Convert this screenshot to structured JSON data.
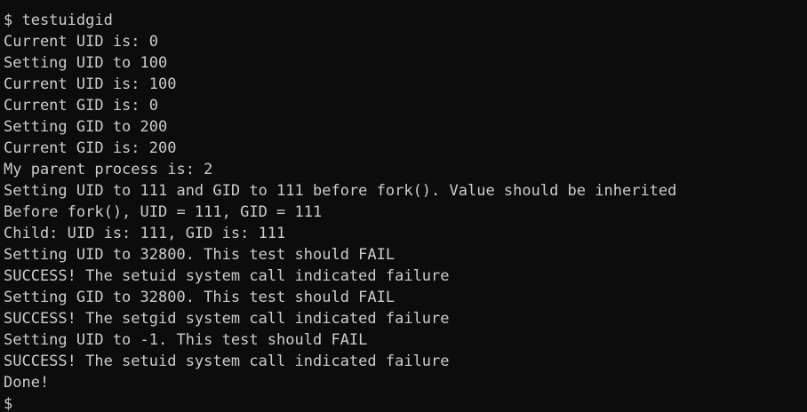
{
  "terminal": {
    "background": "#0c0c0c",
    "foreground": "#cccccc",
    "lines": [
      "$ testuidgid",
      "Current UID is: 0",
      "Setting UID to 100",
      "Current UID is: 100",
      "Current GID is: 0",
      "Setting GID to 200",
      "Current GID is: 200",
      "My parent process is: 2",
      "Setting UID to 111 and GID to 111 before fork(). Value should be inherited",
      "Before fork(), UID = 111, GID = 111",
      "Child: UID is: 111, GID is: 111",
      "Setting UID to 32800. This test should FAIL",
      "SUCCESS! The setuid system call indicated failure",
      "Setting GID to 32800. This test should FAIL",
      "SUCCESS! The setgid system call indicated failure",
      "Setting UID to -1. This test should FAIL",
      "SUCCESS! The setuid system call indicated failure",
      "Done!"
    ],
    "prompt": "$"
  }
}
